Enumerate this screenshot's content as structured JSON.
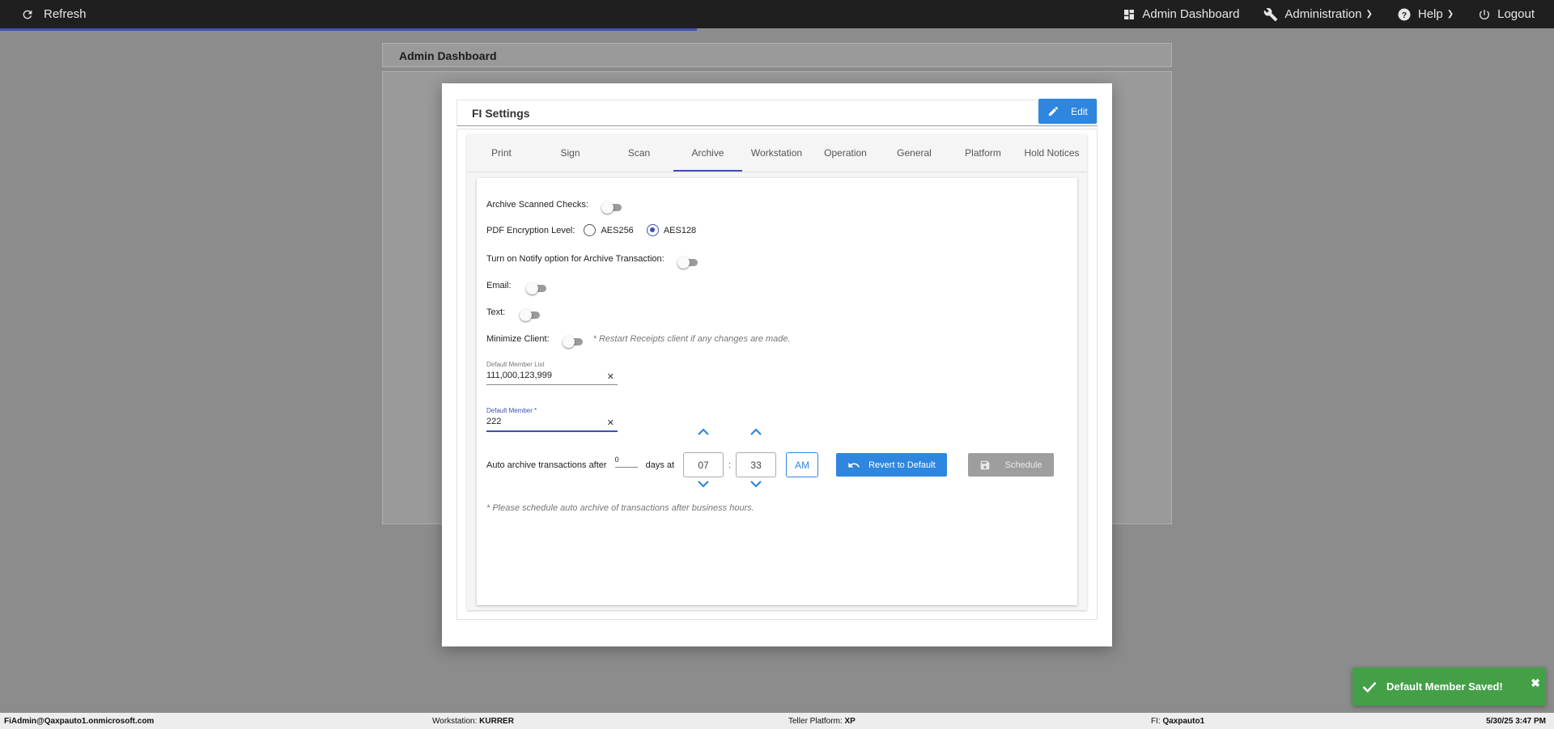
{
  "topbar": {
    "refresh_label": "Refresh",
    "nav": {
      "admin_dashboard": "Admin Dashboard",
      "administration": "Administration",
      "help": "Help",
      "logout": "Logout"
    }
  },
  "dashboard": {
    "title": "Admin Dashboard"
  },
  "modal": {
    "title": "FI Settings",
    "edit_label": "Edit",
    "tabs": [
      "Print",
      "Sign",
      "Scan",
      "Archive",
      "Workstation",
      "Operation",
      "General",
      "Platform",
      "Hold Notices"
    ],
    "active_tab": "Archive"
  },
  "archive": {
    "archive_scanned_checks_label": "Archive Scanned Checks:",
    "pdf_encryption_label": "PDF Encryption Level:",
    "aes256_label": "AES256",
    "aes128_label": "AES128",
    "notify_label": "Turn on Notify option for Archive Transaction:",
    "email_label": "Email:",
    "text_label": "Text:",
    "minimize_label": "Minimize Client:",
    "minimize_hint": "* Restart Receipts client if any changes are made.",
    "member_list_label": "Default Member List",
    "member_list_value": "111,000,123,999",
    "default_member_label": "Default Member *",
    "default_member_value": "222",
    "auto_archive_label": "Auto archive transactions after",
    "days_value": "0",
    "days_at_label": "days at",
    "hour": "07",
    "colon": ":",
    "minute": "33",
    "ampm": "AM",
    "revert_label": "Revert to Default",
    "schedule_label": "Schedule",
    "schedule_hint": "* Please schedule auto archive of transactions after business hours."
  },
  "toast": {
    "message": "Default Member Saved!"
  },
  "statusbar": {
    "user": "FiAdmin@Qaxpauto1.onmicrosoft.com",
    "workstation_label": "Workstation:",
    "workstation_value": "KURRER",
    "platform_label": "Teller Platform:",
    "platform_value": "XP",
    "fi_label": "FI:",
    "fi_value": "Qaxpauto1",
    "datetime": "5/30/25 3:47 PM"
  },
  "colors": {
    "accent": "#2e86de",
    "tab_indicator": "#3f51b5",
    "toast_success": "#43a047",
    "topbar_bg": "#1f1f1f"
  }
}
